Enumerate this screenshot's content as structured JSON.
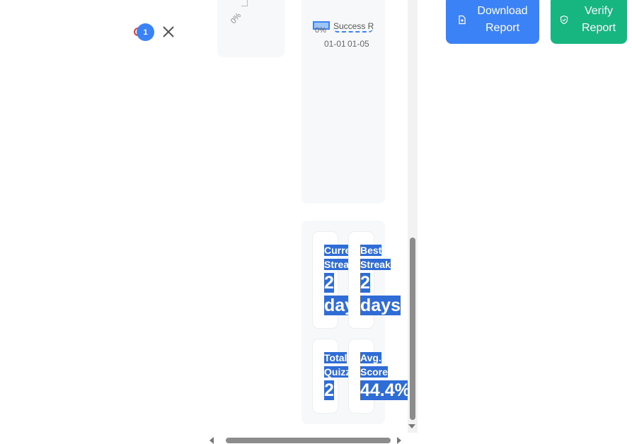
{
  "notifications": {
    "count": "1"
  },
  "chart": {
    "y_tick": "0%",
    "legend_label": "Success R",
    "x_ticks": [
      "01-01",
      "01-05"
    ],
    "left_tick": "0%",
    "colors": {
      "series": "#3b82f6"
    }
  },
  "stats": [
    {
      "label_line1": "Curre",
      "label_line2": "Streal",
      "value_line1": "2",
      "value_line2": "day"
    },
    {
      "label_line1": "Best",
      "label_line2": "Streak",
      "value_line1": "2",
      "value_line2": "days"
    },
    {
      "label_line1": "Total",
      "label_line2": "Quizz",
      "value_line1": "2",
      "value_line2": ""
    },
    {
      "label_line1": "Avg.",
      "label_line2": "Score",
      "value_line1": "44.4%",
      "value_line2": ""
    }
  ],
  "actions": {
    "download_label": "Download Report",
    "verify_label": "Verify Report",
    "colors": {
      "download": "#3b82f6",
      "verify": "#17b57f"
    }
  },
  "icons": [
    "notification-icon",
    "close-icon",
    "file-icon",
    "shield-icon"
  ]
}
